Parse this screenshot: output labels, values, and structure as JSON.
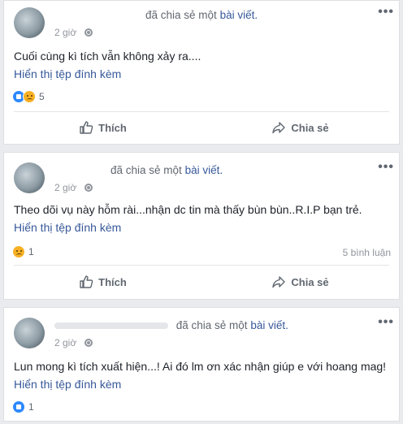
{
  "posts": [
    {
      "header_action": "đã chia sẻ một",
      "header_link": "bài viết.",
      "time": "2 giờ",
      "text": "Cuối cùng kì tích vẫn không xảy ra....",
      "attachment": "Hiển thị tệp đính kèm",
      "reactions": [
        "like",
        "sad"
      ],
      "reaction_count": "5",
      "comments": "",
      "like_label": "Thích",
      "share_label": "Chia sẻ"
    },
    {
      "header_action": "đã chia sẻ một",
      "header_link": "bài viết.",
      "time": "2 giờ",
      "text": "Theo dõi vụ này hỗm rài...nhận dc tin mà thấy bùn bùn..R.I.P bạn trẻ.",
      "attachment": "Hiển thị tệp đính kèm",
      "reactions": [
        "sad"
      ],
      "reaction_count": "1",
      "comments": "5 bình luận",
      "like_label": "Thích",
      "share_label": "Chia sẻ"
    },
    {
      "header_action": "đã chia sẻ một",
      "header_link": "bài viết.",
      "time": "2 giờ",
      "text": "Lun mong kì tích xuất hiện...! Ai đó lm ơn xác nhận giúp e với hoang mag!",
      "attachment": "Hiển thị tệp đính kèm",
      "reactions": [
        "like"
      ],
      "reaction_count": "1"
    }
  ],
  "icons": {
    "like": "thumbs-up-icon",
    "share": "share-arrow-icon",
    "more": "ellipsis-icon",
    "audience": "globe-icon"
  },
  "colors": {
    "link": "#365899",
    "like_reaction": "#2d88ff",
    "sad_reaction": "#f7b125",
    "background": "#e9ebee"
  }
}
